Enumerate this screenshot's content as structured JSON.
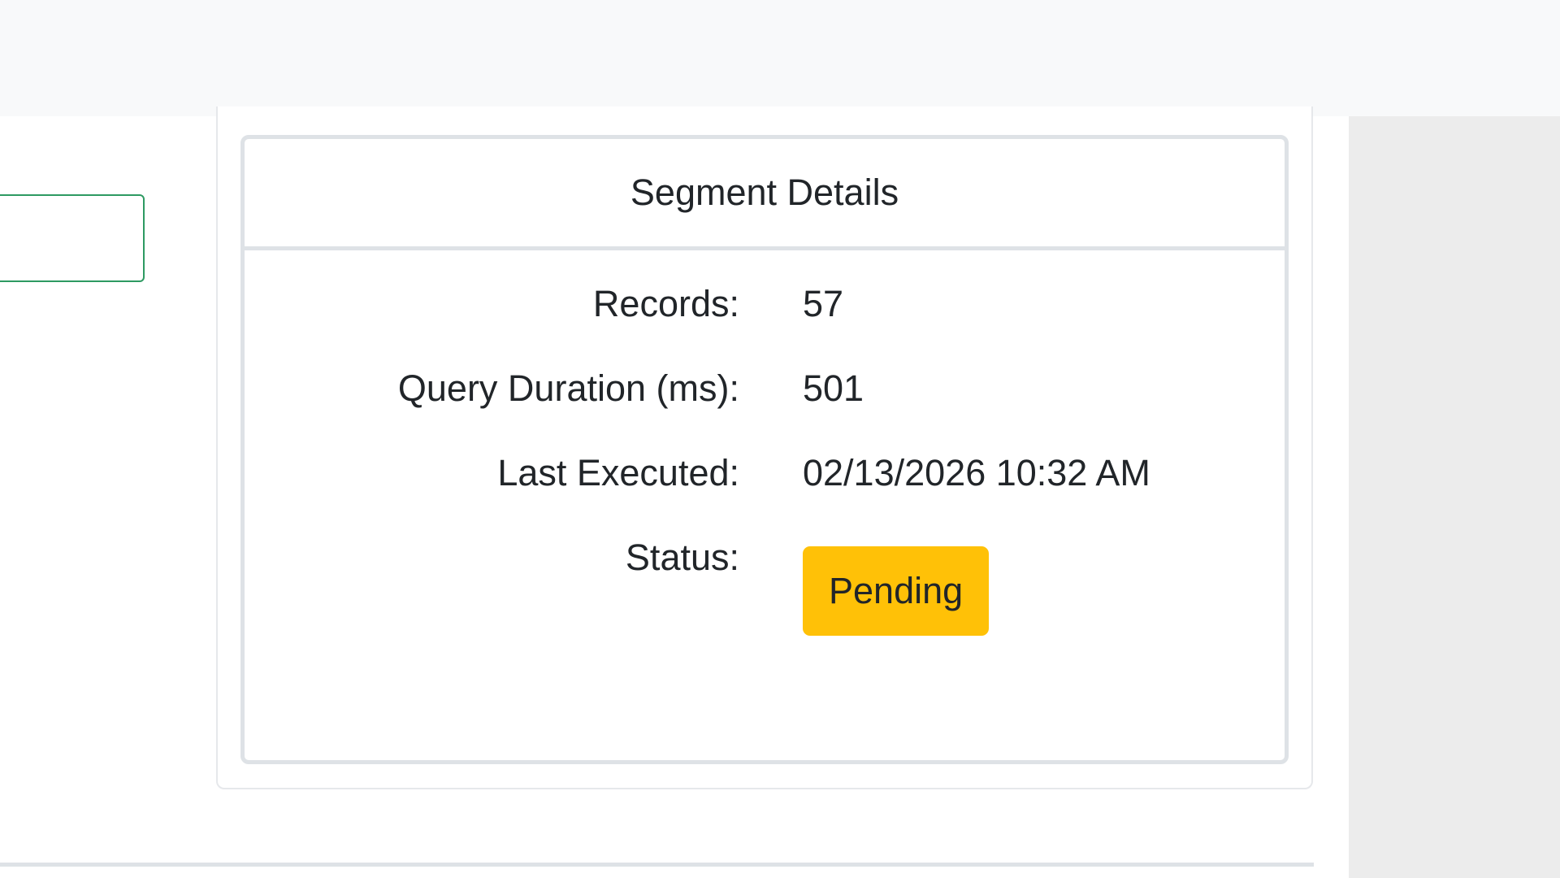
{
  "segment_details": {
    "title": "Segment Details",
    "rows": [
      {
        "label": "Records:",
        "value": "57"
      },
      {
        "label": "Query Duration (ms):",
        "value": "501"
      },
      {
        "label": "Last Executed:",
        "value": "02/13/2026 10:32 AM"
      }
    ],
    "status": {
      "label": "Status:",
      "value": "Pending",
      "color": "#ffc107"
    }
  },
  "colors": {
    "input_border": "#2e9a62",
    "card_border": "#dee2e6",
    "side_panel": "#ececec",
    "top_bar": "#f8f9fa"
  }
}
